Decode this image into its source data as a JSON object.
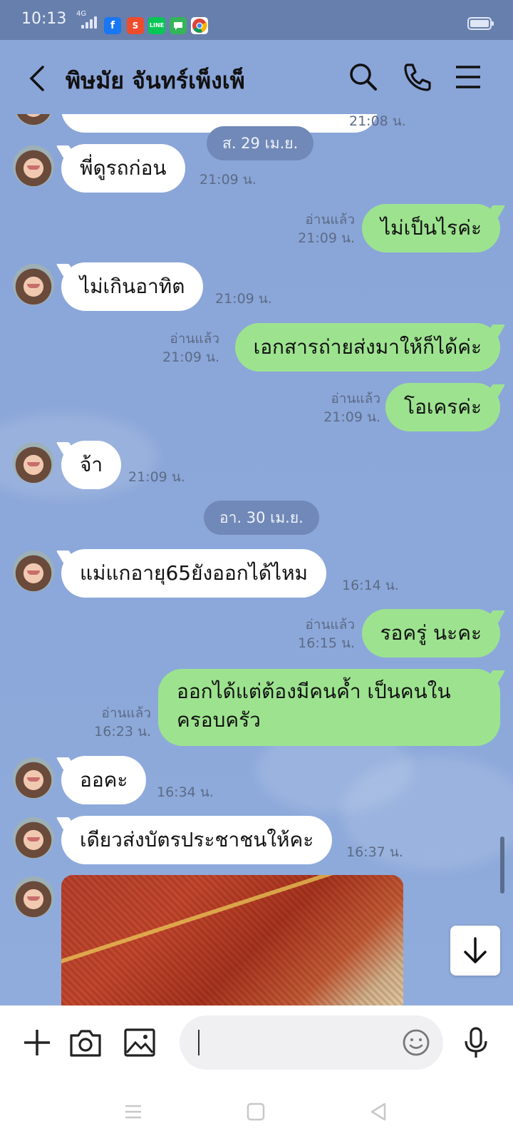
{
  "status_bar": {
    "time": "10:13",
    "network": "4G",
    "notification_icons": [
      "facebook-icon",
      "shopee-icon",
      "line-icon",
      "message-icon",
      "chrome-icon"
    ]
  },
  "header": {
    "contact_name": "พิษมัย จันทร์เพ็งเพ็",
    "icons": [
      "back-arrow-icon",
      "search-icon",
      "phone-icon",
      "menu-icon"
    ]
  },
  "chat": {
    "date_separators": [
      "ส. 29 เม.ย.",
      "อา. 30 เม.ย."
    ],
    "partial_top": {
      "time": "21:08 น."
    },
    "messages": [
      {
        "dir": "in",
        "text": "พี่ดูรถก่อน",
        "time": "21:09 น."
      },
      {
        "dir": "out",
        "text": "ไม่เป็นไรค่ะ",
        "read": "อ่านแล้ว",
        "time": "21:09 น."
      },
      {
        "dir": "in",
        "text": "ไม่เกินอาทิต",
        "time": "21:09 น."
      },
      {
        "dir": "out",
        "text": "เอกสารถ่ายส่งมาให้ก็ได้ค่ะ",
        "read": "อ่านแล้ว",
        "time": "21:09 น."
      },
      {
        "dir": "out",
        "text": "โอเครค่ะ",
        "read": "อ่านแล้ว",
        "time": "21:09 น."
      },
      {
        "dir": "in",
        "text": "จ้า",
        "time": "21:09 น."
      },
      {
        "dir": "in",
        "text": "แม่แกอายุ65ยังออกได้ไหม",
        "time": "16:14 น."
      },
      {
        "dir": "out",
        "text": "รอครู่ นะคะ",
        "read": "อ่านแล้ว",
        "time": "16:15 น."
      },
      {
        "dir": "out",
        "text_line1": "ออกได้แต่ต้องมีคนค้ำ เป็นคนใน",
        "text_line2": "ครอบครัว",
        "read": "อ่านแล้ว",
        "time": "16:23 น."
      },
      {
        "dir": "in",
        "text": "ออคะ",
        "time": "16:34 น."
      },
      {
        "dir": "in",
        "text": "เดียวส่งบัตรประชาชนให้คะ",
        "time": "16:37 น."
      }
    ]
  },
  "input_bar": {
    "message_value": "",
    "message_placeholder": "",
    "icons": [
      "plus-icon",
      "camera-icon",
      "gallery-icon",
      "emoji-icon",
      "microphone-icon"
    ]
  },
  "nav_bar": {
    "icons": [
      "recents-icon",
      "home-icon",
      "back-icon"
    ]
  },
  "colors": {
    "chat_background": "#8aa5d8",
    "status_bar": "#677fac",
    "outgoing_bubble": "#9de38f",
    "incoming_bubble": "#ffffff",
    "date_pill": "#7189b8"
  }
}
